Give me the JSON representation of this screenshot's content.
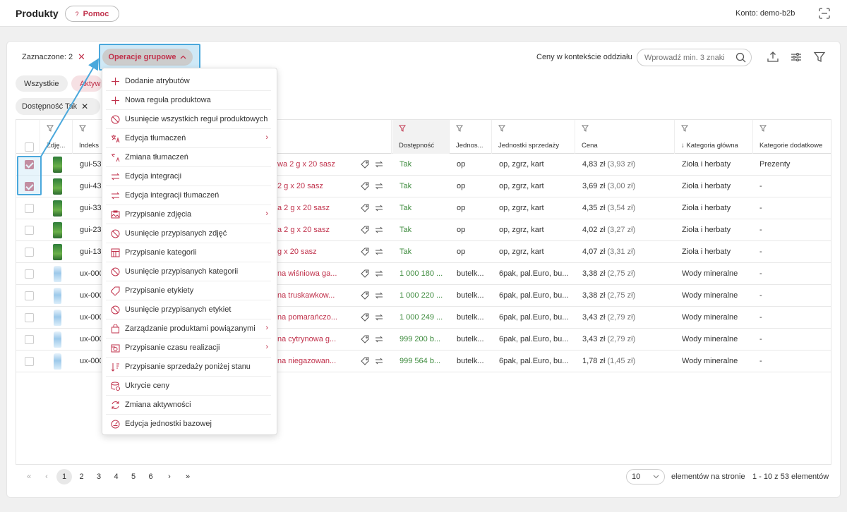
{
  "header": {
    "title": "Produkty",
    "help_label": "Pomoc",
    "help_icon": "?",
    "account": "Konto: demo-b2b"
  },
  "toolbar": {
    "selected_label": "Zaznaczone: 2",
    "bulk_ops_label": "Operacje grupowe",
    "price_context_label": "Ceny w kontekście oddziału",
    "search_placeholder": "Wprowadź min. 3 znaki"
  },
  "tabs": {
    "all": "Wszystkie",
    "active": "Aktyw"
  },
  "filter_chip": "Dostępność Tak",
  "columns": {
    "photo": "Zdję...",
    "index": "Indeks",
    "availability": "Dostępność",
    "unit": "Jednos...",
    "sales_units": "Jednostki sprzedaży",
    "price": "Cena",
    "main_category": "Kategoria główna",
    "extra_categories": "Kategorie dodatkowe"
  },
  "rows": [
    {
      "checked": true,
      "thumb": "tea",
      "index": "gui-53",
      "name": "wa 2 g x 20 sasz",
      "availability": "Tak",
      "unit": "op",
      "sales_units": "op, zgrz, kart",
      "price": "4,83 zł",
      "price_net": "(3,93 zł)",
      "main_category": "Zioła i herbaty",
      "extra_categories": "Prezenty"
    },
    {
      "checked": true,
      "thumb": "tea",
      "index": "gui-43",
      "name": "2 g x 20 sasz",
      "availability": "Tak",
      "unit": "op",
      "sales_units": "op, zgrz, kart",
      "price": "3,69 zł",
      "price_net": "(3,00 zł)",
      "main_category": "Zioła i herbaty",
      "extra_categories": "-"
    },
    {
      "checked": false,
      "thumb": "tea",
      "index": "gui-33",
      "name": "a 2 g x 20 sasz",
      "availability": "Tak",
      "unit": "op",
      "sales_units": "op, zgrz, kart",
      "price": "4,35 zł",
      "price_net": "(3,54 zł)",
      "main_category": "Zioła i herbaty",
      "extra_categories": "-"
    },
    {
      "checked": false,
      "thumb": "tea",
      "index": "gui-23",
      "name": "a 2 g x 20 sasz",
      "availability": "Tak",
      "unit": "op",
      "sales_units": "op, zgrz, kart",
      "price": "4,02 zł",
      "price_net": "(3,27 zł)",
      "main_category": "Zioła i herbaty",
      "extra_categories": "-"
    },
    {
      "checked": false,
      "thumb": "tea",
      "index": "gui-13",
      "name": "g x 20 sasz",
      "availability": "Tak",
      "unit": "op",
      "sales_units": "op, zgrz, kart",
      "price": "4,07 zł",
      "price_net": "(3,31 zł)",
      "main_category": "Zioła i herbaty",
      "extra_categories": "-"
    },
    {
      "checked": false,
      "thumb": "water",
      "index": "ux-000",
      "name": "na wiśniowa ga...",
      "availability": "1 000 180 ...",
      "unit": "butelk...",
      "sales_units": "6pak, pal.Euro, bu...",
      "price": "3,38 zł",
      "price_net": "(2,75 zł)",
      "main_category": "Wody mineralne",
      "extra_categories": "-"
    },
    {
      "checked": false,
      "thumb": "water",
      "index": "ux-000",
      "name": "na truskawkow...",
      "availability": "1 000 220 ...",
      "unit": "butelk...",
      "sales_units": "6pak, pal.Euro, bu...",
      "price": "3,38 zł",
      "price_net": "(2,75 zł)",
      "main_category": "Wody mineralne",
      "extra_categories": "-"
    },
    {
      "checked": false,
      "thumb": "water",
      "index": "ux-000",
      "name": "na pomarańczo...",
      "availability": "1 000 249 ...",
      "unit": "butelk...",
      "sales_units": "6pak, pal.Euro, bu...",
      "price": "3,43 zł",
      "price_net": "(2,79 zł)",
      "main_category": "Wody mineralne",
      "extra_categories": "-"
    },
    {
      "checked": false,
      "thumb": "water",
      "index": "ux-000",
      "name": "na cytrynowa g...",
      "availability": "999 200 b...",
      "unit": "butelk...",
      "sales_units": "6pak, pal.Euro, bu...",
      "price": "3,43 zł",
      "price_net": "(2,79 zł)",
      "main_category": "Wody mineralne",
      "extra_categories": "-"
    },
    {
      "checked": false,
      "thumb": "water",
      "index": "ux-000",
      "name": "na niegazowan...",
      "availability": "999 564 b...",
      "unit": "butelk...",
      "sales_units": "6pak, pal.Euro, bu...",
      "price": "1,78 zł",
      "price_net": "(1,45 zł)",
      "main_category": "Wody mineralne",
      "extra_categories": "-"
    }
  ],
  "menu": [
    {
      "label": "Dodanie atrybutów",
      "icon": "plus-icon",
      "sub": false
    },
    {
      "label": "Nowa reguła produktowa",
      "icon": "plus-icon",
      "sub": false
    },
    {
      "label": "Usunięcie wszystkich reguł produktowych",
      "icon": "ban-icon",
      "sub": false
    },
    {
      "label": "Edycja tłumaczeń",
      "icon": "translate-icon",
      "sub": true
    },
    {
      "label": "Zmiana tłumaczeń",
      "icon": "translate-alt-icon",
      "sub": false
    },
    {
      "label": "Edycja integracji",
      "icon": "swap-icon",
      "sub": false
    },
    {
      "label": "Edycja integracji tłumaczeń",
      "icon": "swap-icon",
      "sub": false
    },
    {
      "label": "Przypisanie zdjęcia",
      "icon": "image-icon",
      "sub": true
    },
    {
      "label": "Usunięcie przypisanych zdjęć",
      "icon": "ban-icon",
      "sub": false
    },
    {
      "label": "Przypisanie kategorii",
      "icon": "category-icon",
      "sub": false
    },
    {
      "label": "Usunięcie przypisanych kategorii",
      "icon": "ban-icon",
      "sub": false
    },
    {
      "label": "Przypisanie etykiety",
      "icon": "tag-icon",
      "sub": false
    },
    {
      "label": "Usunięcie przypisanych etykiet",
      "icon": "ban-icon",
      "sub": false
    },
    {
      "label": "Zarządzanie produktami powiązanymi",
      "icon": "bag-icon",
      "sub": true
    },
    {
      "label": "Przypisanie czasu realizacji",
      "icon": "clock-icon",
      "sub": true
    },
    {
      "label": "Przypisanie sprzedaży poniżej stanu",
      "icon": "sort-icon",
      "sub": false
    },
    {
      "label": "Ukrycie ceny",
      "icon": "coins-icon",
      "sub": false
    },
    {
      "label": "Zmiana aktywności",
      "icon": "refresh-icon",
      "sub": false
    },
    {
      "label": "Edycja jednostki bazowej",
      "icon": "gauge-icon",
      "sub": false
    }
  ],
  "pagination": {
    "pages": [
      "1",
      "2",
      "3",
      "4",
      "5",
      "6"
    ],
    "current": "1",
    "per_page": "10",
    "per_page_label": "elementów na stronie",
    "total_label": "1 - 10 z 53 elementów"
  },
  "colors": {
    "accent": "#c0314b",
    "highlight": "#4aa8dc",
    "green": "#3d8b3d"
  }
}
